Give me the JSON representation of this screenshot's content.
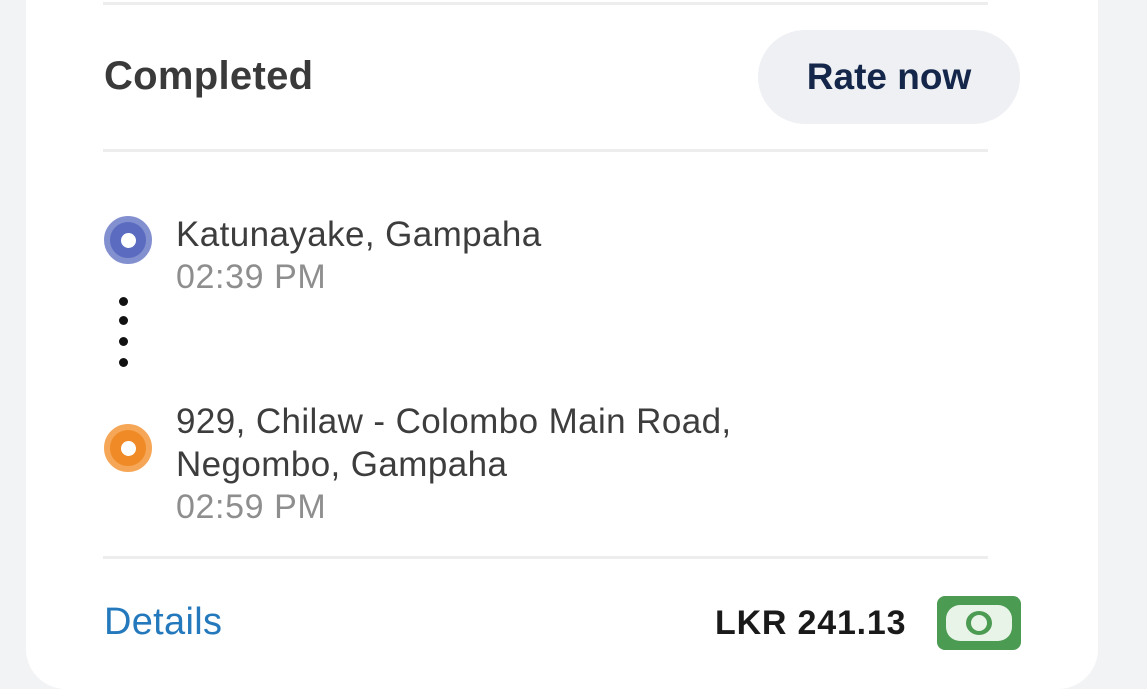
{
  "trip": {
    "status": "Completed",
    "rate_label": "Rate now",
    "pickup": {
      "address": "Katunayake, Gampaha",
      "time": "02:39 PM"
    },
    "dropoff": {
      "address_line1": "929, Chilaw - Colombo Main Road,",
      "address_line2": "Negombo, Gampaha",
      "time": "02:59 PM"
    },
    "details_label": "Details",
    "fare": "LKR 241.13",
    "payment_icon": "cash-icon"
  },
  "colors": {
    "pickup": "#5a6bc0",
    "dropoff": "#f08a26",
    "link": "#2479bd",
    "cash": "#4c9b52"
  }
}
